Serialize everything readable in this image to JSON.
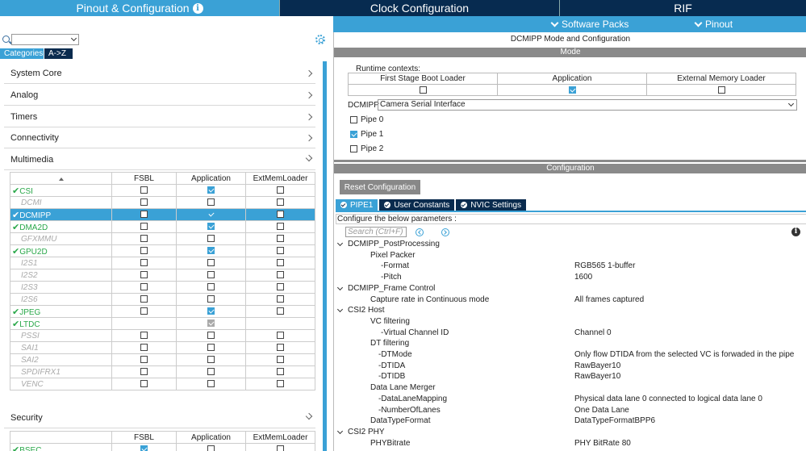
{
  "top_tabs": {
    "pinout_config": "Pinout & Configuration",
    "clock_config": "Clock Configuration",
    "rif": "RIF"
  },
  "sub_menu": {
    "software_packs": "Software Packs",
    "pinout": "Pinout"
  },
  "left": {
    "category_tab": "Categories",
    "az_tab": "A->Z",
    "categories": [
      "System Core",
      "Analog",
      "Timers",
      "Connectivity",
      "Multimedia"
    ],
    "multimedia_table": {
      "headers": [
        "FSBL",
        "Application",
        "ExtMemLoader"
      ],
      "rows": [
        {
          "name": "CSI",
          "state": "on",
          "fsbl": false,
          "app": true,
          "ext": false
        },
        {
          "name": "DCMI",
          "state": "disabled",
          "fsbl": false,
          "app": false,
          "ext": false
        },
        {
          "name": "DCMIPP",
          "state": "selected",
          "fsbl": false,
          "app": true,
          "ext": false
        },
        {
          "name": "DMA2D",
          "state": "on",
          "fsbl": false,
          "app": true,
          "ext": false
        },
        {
          "name": "GFXMMU",
          "state": "disabled",
          "fsbl": false,
          "app": false,
          "ext": false
        },
        {
          "name": "GPU2D",
          "state": "on",
          "fsbl": false,
          "app": true,
          "ext": false
        },
        {
          "name": "I2S1",
          "state": "disabled",
          "fsbl": false,
          "app": false,
          "ext": false
        },
        {
          "name": "I2S2",
          "state": "disabled",
          "fsbl": false,
          "app": false,
          "ext": false
        },
        {
          "name": "I2S3",
          "state": "disabled",
          "fsbl": false,
          "app": false,
          "ext": false
        },
        {
          "name": "I2S6",
          "state": "disabled",
          "fsbl": false,
          "app": false,
          "ext": false
        },
        {
          "name": "JPEG",
          "state": "on",
          "fsbl": false,
          "app": true,
          "ext": false
        },
        {
          "name": "LTDC",
          "state": "on",
          "fsbl": null,
          "app": "gray",
          "ext": null
        },
        {
          "name": "PSSI",
          "state": "disabled",
          "fsbl": false,
          "app": false,
          "ext": false
        },
        {
          "name": "SAI1",
          "state": "disabled",
          "fsbl": false,
          "app": false,
          "ext": false
        },
        {
          "name": "SAI2",
          "state": "disabled",
          "fsbl": false,
          "app": false,
          "ext": false
        },
        {
          "name": "SPDIFRX1",
          "state": "disabled",
          "fsbl": false,
          "app": false,
          "ext": false
        },
        {
          "name": "VENC",
          "state": "disabled",
          "fsbl": false,
          "app": false,
          "ext": false
        }
      ]
    },
    "security": "Security",
    "security_table": {
      "headers": [
        "FSBL",
        "Application",
        "ExtMemLoader"
      ],
      "rows": [
        {
          "name": "BSEC",
          "state": "on",
          "fsbl": true,
          "app": false,
          "ext": false
        }
      ]
    }
  },
  "right": {
    "title": "DCMIPP Mode and Configuration",
    "mode_bar": "Mode",
    "runtime_contexts_label": "Runtime contexts:",
    "runtime_headers": [
      "First Stage Boot Loader",
      "Application",
      "External Memory Loader"
    ],
    "runtime_values": [
      false,
      true,
      false
    ],
    "dcmipp_label": "DCMIPP",
    "dcmipp_value": "Camera Serial Interface",
    "pipes": [
      {
        "label": "Pipe 0",
        "checked": false
      },
      {
        "label": "Pipe 1",
        "checked": true
      },
      {
        "label": "Pipe 2",
        "checked": false
      }
    ],
    "config_bar": "Configuration",
    "reset_button": "Reset Configuration",
    "tabs": [
      "PIPE1",
      "User Constants",
      "NVIC Settings"
    ],
    "configure_text": "Configure the below parameters :",
    "search_placeholder": "Search (Ctrl+F)",
    "params": [
      {
        "level": 0,
        "key": "DCMIPP_PostProcessing",
        "value": ""
      },
      {
        "level": 1,
        "key": "Pixel Packer",
        "value": ""
      },
      {
        "level": 2,
        "key": "-Format",
        "value": "RGB565 1-buffer"
      },
      {
        "level": 2,
        "key": "-Pitch",
        "value": "1600"
      },
      {
        "level": 0,
        "key": "DCMIPP_Frame Control",
        "value": ""
      },
      {
        "level": 1,
        "key": "Capture rate in Continuous mode",
        "value": "All frames captured"
      },
      {
        "level": 0,
        "key": "CSI2 Host",
        "value": ""
      },
      {
        "level": 1,
        "key": "VC filtering",
        "value": ""
      },
      {
        "level": 2,
        "key": "-Virtual Channel ID",
        "value": "Channel 0"
      },
      {
        "level": 1,
        "key": "DT filtering",
        "value": ""
      },
      {
        "level": 3,
        "key": "-DTMode",
        "value": "Only flow DTIDA from the selected VC is forwaded in the pipe"
      },
      {
        "level": 3,
        "key": "-DTIDA",
        "value": "RawBayer10"
      },
      {
        "level": 3,
        "key": "-DTIDB",
        "value": "RawBayer10"
      },
      {
        "level": 1,
        "key": "Data Lane Merger",
        "value": ""
      },
      {
        "level": 3,
        "key": "-DataLaneMapping",
        "value": "Physical data lane 0 connected to logical data lane 0"
      },
      {
        "level": 3,
        "key": "-NumberOfLanes",
        "value": "One Data Lane"
      },
      {
        "level": 1,
        "key": "DataTypeFormat",
        "value": "DataTypeFormatBPP6"
      },
      {
        "level": 0,
        "key": "CSI2 PHY",
        "value": ""
      },
      {
        "level": 1,
        "key": "PHYBitrate",
        "value": "PHY BitRate 80"
      }
    ]
  },
  "colors": {
    "accent": "#3aa1d6",
    "dark_tab": "#072b50",
    "section_bar": "#8a8a8a",
    "enabled_green": "#2aa84a"
  }
}
